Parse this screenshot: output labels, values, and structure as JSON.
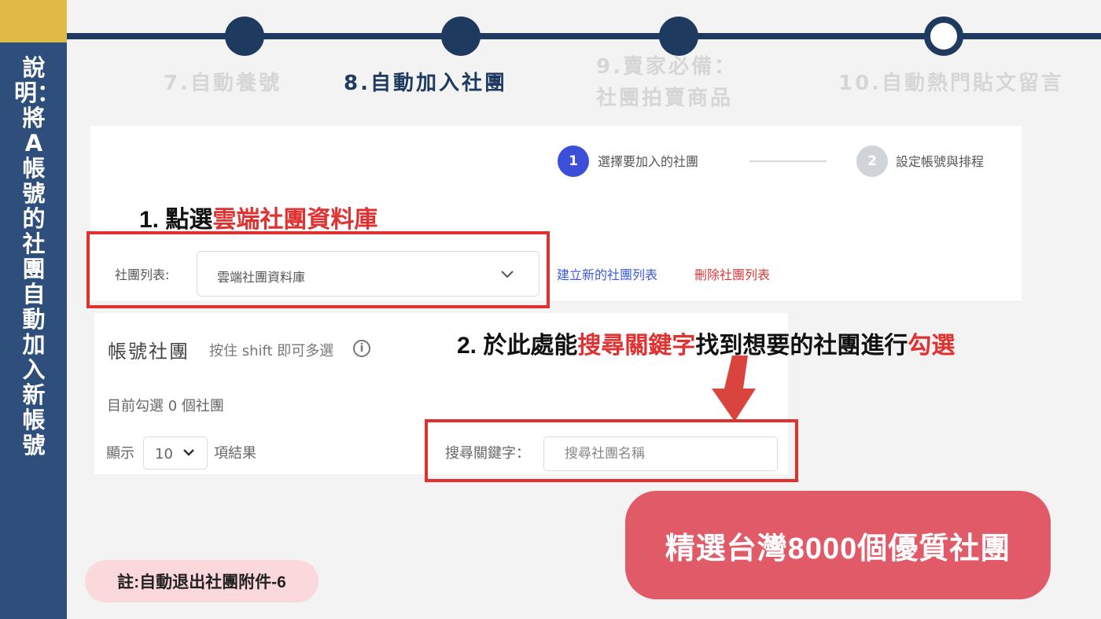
{
  "sidebar": {
    "title": "說明：將A帳號的社團自動加入新帳號"
  },
  "steps": [
    {
      "label": "7.自動養號",
      "state": "inactive"
    },
    {
      "label": "8.自動加入社團",
      "state": "active"
    },
    {
      "label_line1": "9.賣家必備：",
      "label_line2": "社團拍賣商品",
      "state": "inactive"
    },
    {
      "label": "10.自動熱門貼文留言",
      "state": "current"
    }
  ],
  "wizard": {
    "step1": {
      "number": "1",
      "label": "選擇要加入的社團",
      "color": "#3b4fd8"
    },
    "step2": {
      "number": "2",
      "label": "設定帳號與排程",
      "color": "#d0d3d8"
    }
  },
  "group_list": {
    "label": "社團列表:",
    "selected": "雲端社團資料庫",
    "create_link": "建立新的社團列表",
    "delete_link": "刪除社團列表"
  },
  "account_groups": {
    "title": "帳號社團",
    "hint": "按住 shift 即可多選",
    "info_icon": "i",
    "selected_count": "目前勾選 0 個社團",
    "show_prefix": "顯示",
    "page_length": "10",
    "show_suffix": "項結果",
    "search_label": "搜尋關鍵字：",
    "search_placeholder": "搜尋社團名稱"
  },
  "annotations": {
    "note1_prefix": "1. 點選",
    "note1_highlight": "雲端社團資料庫",
    "note2_prefix": "2.  於此處能",
    "note2_highlight1": "搜尋關鍵字",
    "note2_middle": "找到想要的社團進行",
    "note2_highlight2": "勾選"
  },
  "footer": {
    "note": "註:自動退出社團附件-6",
    "badge": "精選台灣8000個優質社團"
  },
  "colors": {
    "navy": "#1f3a5f",
    "sidebar": "#2e4f7c",
    "gold": "#e0bb45",
    "red": "#e03131",
    "badge": "#e05a68",
    "pill": "#fbd8dc"
  }
}
